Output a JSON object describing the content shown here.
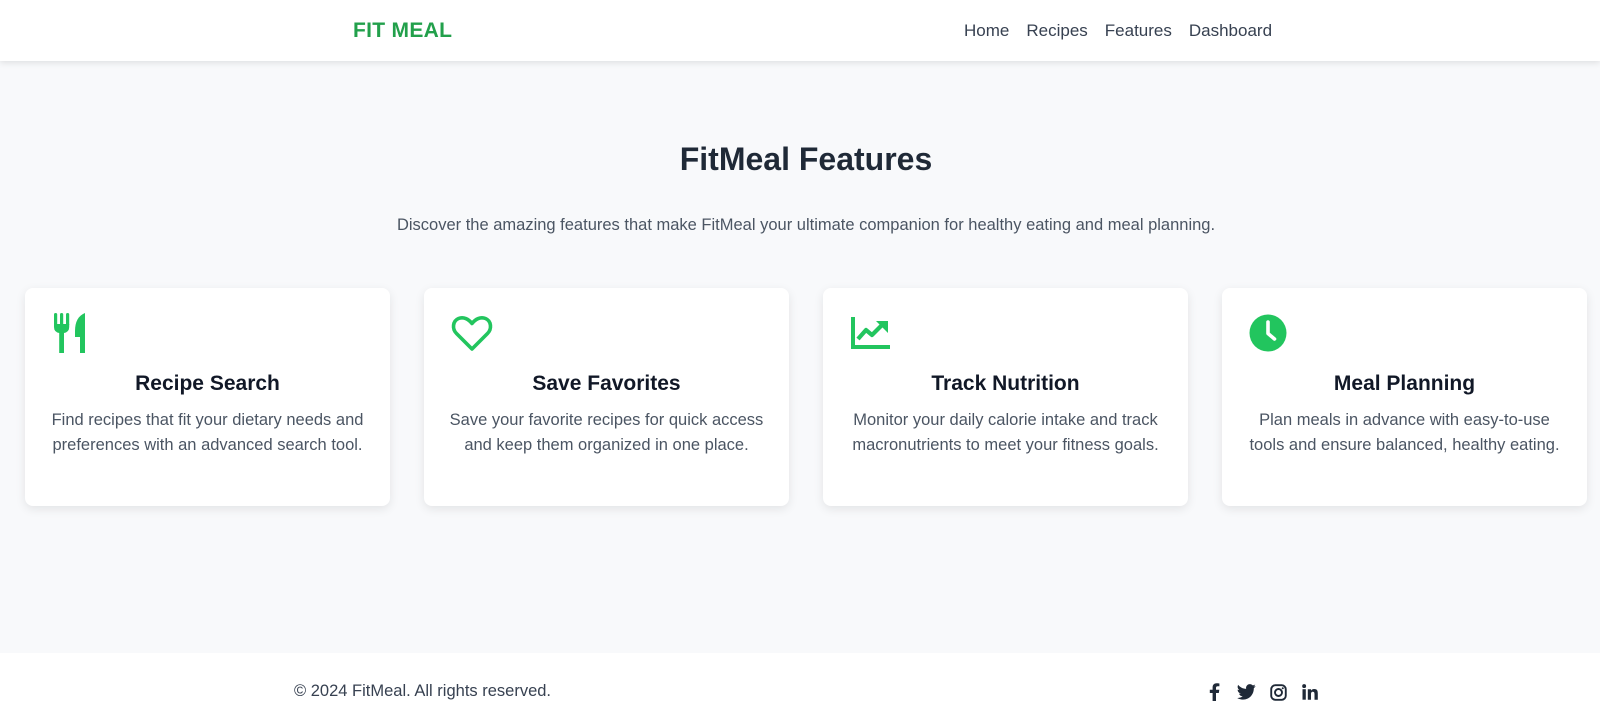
{
  "header": {
    "brand": "FIT MEAL",
    "nav": [
      {
        "label": "Home"
      },
      {
        "label": "Recipes"
      },
      {
        "label": "Features"
      },
      {
        "label": "Dashboard"
      }
    ]
  },
  "hero": {
    "title": "FitMeal Features",
    "subtitle": "Discover the amazing features that make FitMeal your ultimate companion for healthy eating and meal planning."
  },
  "features": [
    {
      "icon": "utensils-icon",
      "title": "Recipe Search",
      "description": "Find recipes that fit your dietary needs and preferences with an advanced search tool."
    },
    {
      "icon": "heart-icon",
      "title": "Save Favorites",
      "description": "Save your favorite recipes for quick access and keep them organized in one place."
    },
    {
      "icon": "chart-line-icon",
      "title": "Track Nutrition",
      "description": "Monitor your daily calorie intake and track macronutrients to meet your fitness goals."
    },
    {
      "icon": "clock-icon",
      "title": "Meal Planning",
      "description": "Plan meals in advance with easy-to-use tools and ensure balanced, healthy eating."
    }
  ],
  "footer": {
    "copyright": "© 2024 FitMeal. All rights reserved.",
    "socials": [
      "facebook-icon",
      "twitter-icon",
      "instagram-icon",
      "linkedin-icon"
    ]
  },
  "colors": {
    "brand": "#22a04b",
    "icon_green": "#22c55e",
    "background": "#f8f9fb",
    "text_dark": "#1f2937",
    "text_muted": "#4b5563"
  }
}
